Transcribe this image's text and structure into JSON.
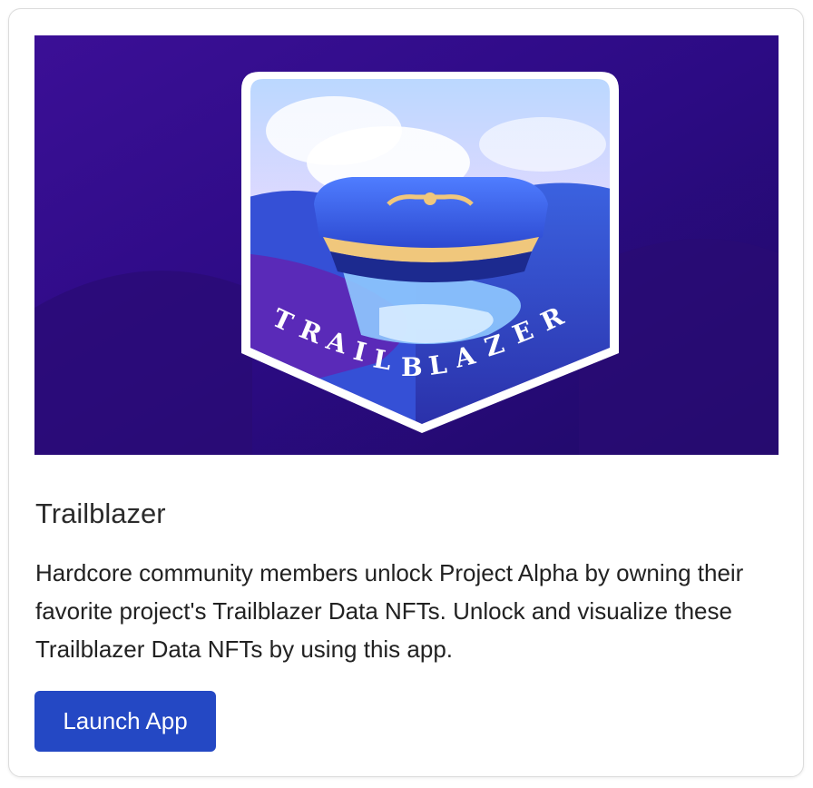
{
  "card": {
    "badge_text": "TRAILBLAZER",
    "title": "Trailblazer",
    "description": "Hardcore community members unlock Project Alpha by owning their favorite project's Trailblazer Data NFTs. Unlock and visualize these Trailblazer Data NFTs by using this app.",
    "button_label": "Launch App"
  },
  "colors": {
    "accent": "#2448c4",
    "hero_bg": "#2a0a7a"
  }
}
